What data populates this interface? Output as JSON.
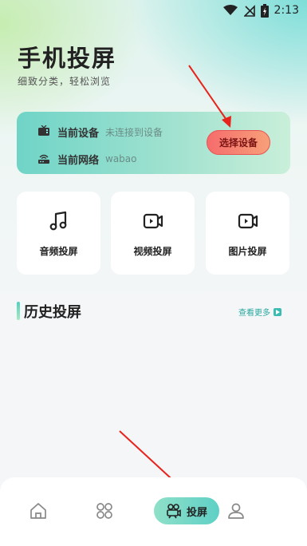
{
  "status_bar": {
    "time": "2:13"
  },
  "header": {
    "title": "手机投屏",
    "subtitle": "细致分类，轻松浏览"
  },
  "device_card": {
    "current_device_label": "当前设备",
    "current_device_value": "未连接到设备",
    "current_network_label": "当前网络",
    "current_network_value": "wabao",
    "select_button": "选择设备"
  },
  "features": [
    {
      "label": "音频投屏",
      "icon": "music-note-icon"
    },
    {
      "label": "视频投屏",
      "icon": "video-camera-icon"
    },
    {
      "label": "图片投屏",
      "icon": "video-camera-icon"
    }
  ],
  "history": {
    "title": "历史投屏",
    "more": "查看更多"
  },
  "tabbar": {
    "items": [
      {
        "icon": "home-icon"
      },
      {
        "icon": "grid-icon"
      },
      {
        "label": "投屏",
        "icon": "projector-icon",
        "active": true
      },
      {
        "icon": "user-icon"
      }
    ]
  },
  "colors": {
    "accent": "#5fd0c6",
    "button": "#f66c6c"
  }
}
